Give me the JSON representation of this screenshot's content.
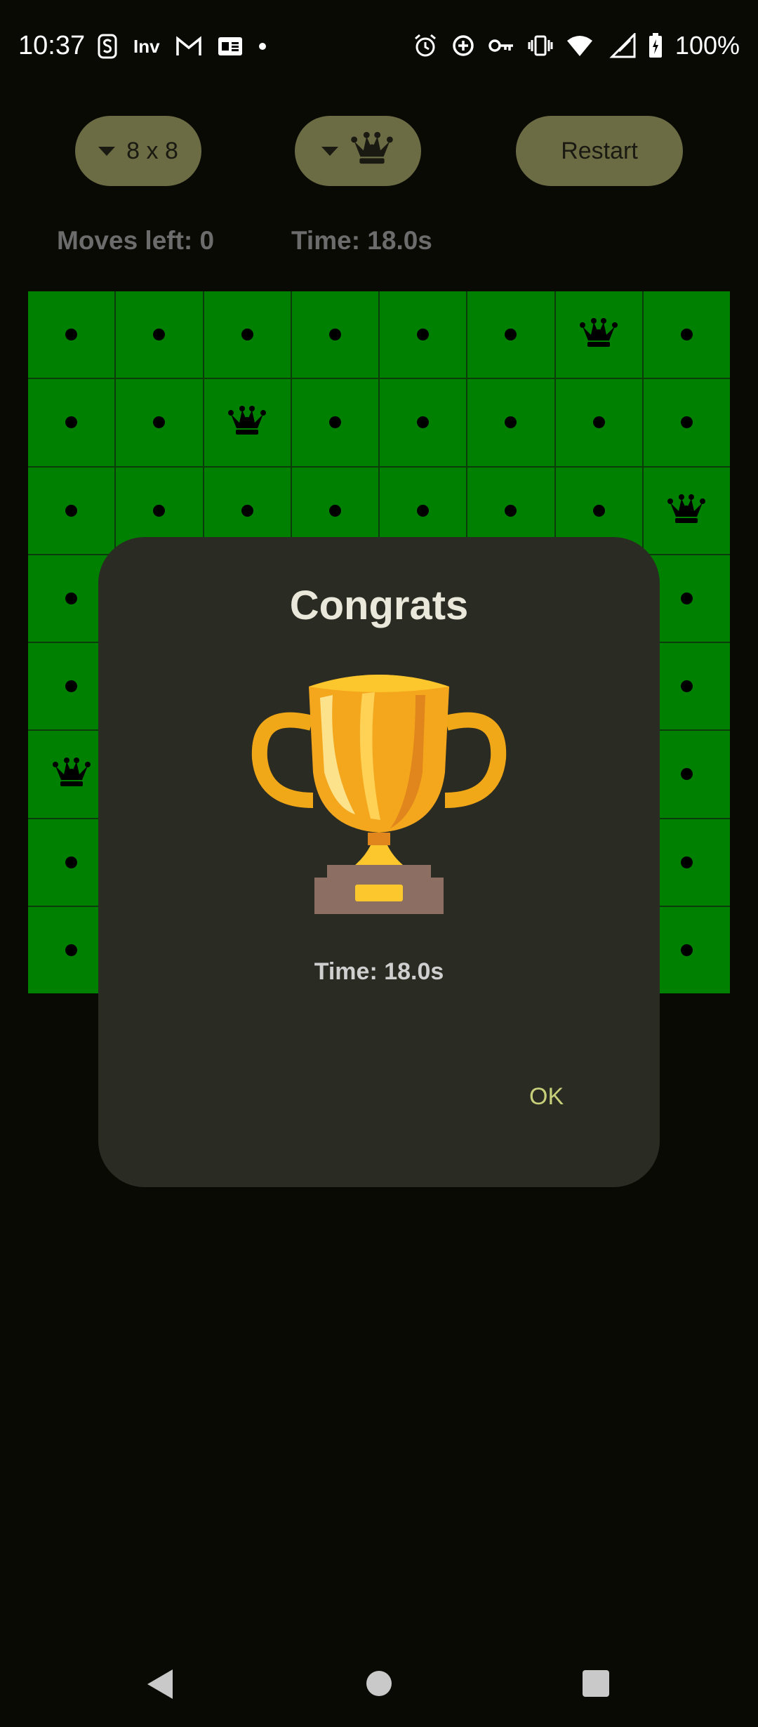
{
  "status_bar": {
    "time": "10:37",
    "left_icons": [
      "s-app-icon",
      "inv-app-icon",
      "gmail-icon",
      "ge-app-icon",
      "dot-icon"
    ],
    "inv_label": "Inv",
    "right_icons": [
      "alarm-icon",
      "data-saver-icon",
      "vpn-key-icon",
      "vibrate-icon",
      "wifi-icon",
      "signal-icon",
      "battery-icon"
    ],
    "battery_text": "100%"
  },
  "toolbar": {
    "size_label": "8 x 8",
    "piece_icon": "queen-icon",
    "restart_label": "Restart"
  },
  "info": {
    "moves_left": "Moves left: 0",
    "time": "Time: 18.0s"
  },
  "board": {
    "rows": 8,
    "cols": 8,
    "queens": [
      [
        0,
        6
      ],
      [
        1,
        2
      ],
      [
        2,
        7
      ],
      [
        5,
        0
      ]
    ]
  },
  "dialog": {
    "title": "Congrats",
    "icon": "trophy-icon",
    "time_text": "Time: 18.0s",
    "ok_label": "OK"
  },
  "nav": {
    "items": [
      "back-icon",
      "home-icon",
      "recents-icon"
    ]
  },
  "colors": {
    "board_green": "#008000",
    "pill_bg": "#6b6b44",
    "dialog_bg": "#2a2b22",
    "ok_text": "#c8cf7a"
  }
}
